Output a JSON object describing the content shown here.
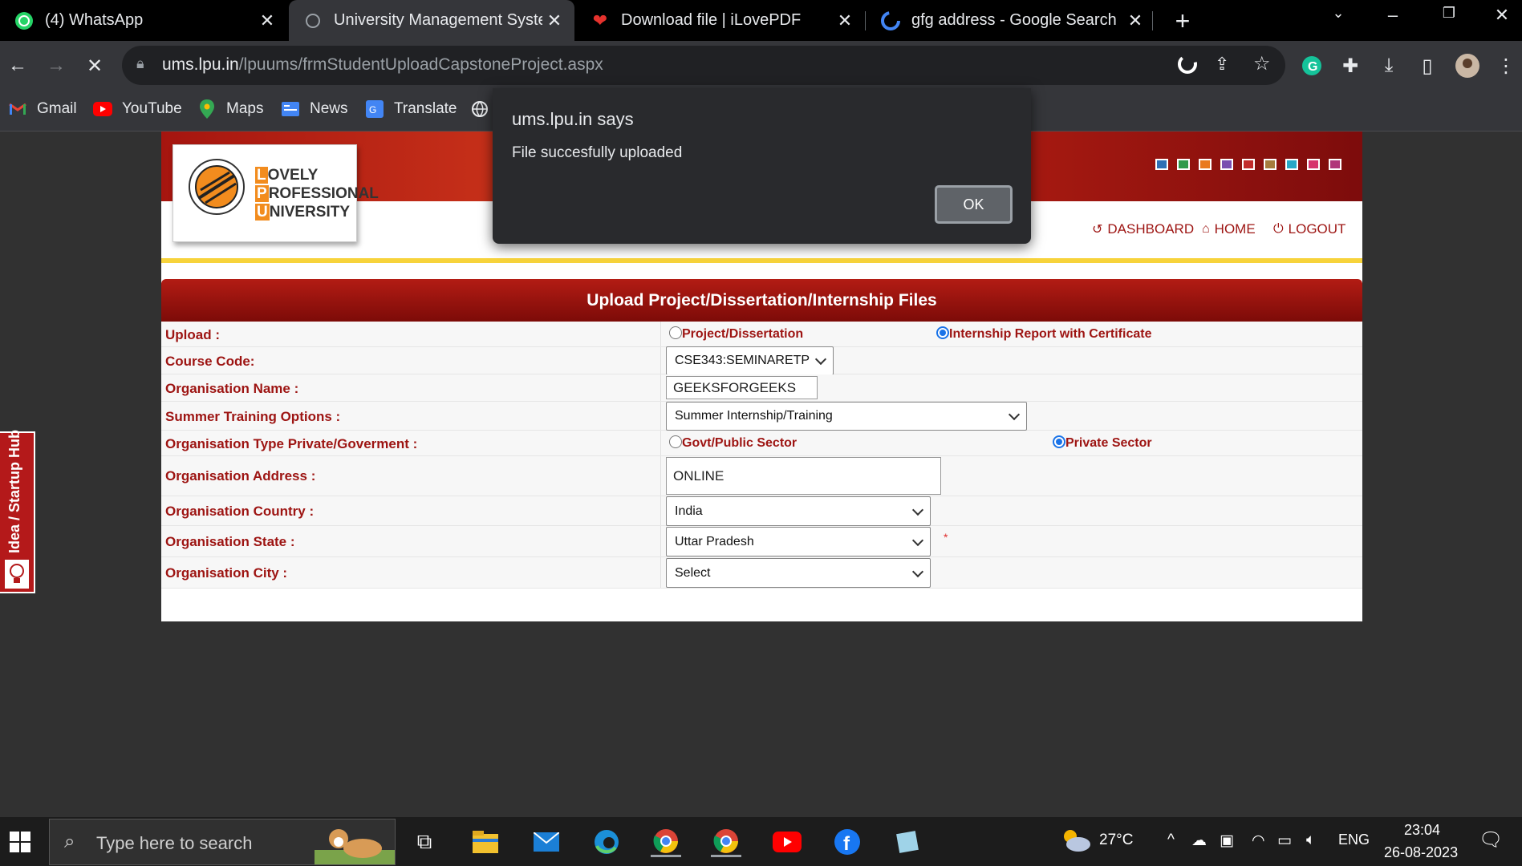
{
  "browser": {
    "tabs": [
      {
        "title": "(4) WhatsApp",
        "active": false
      },
      {
        "title": "University Management System -",
        "active": true
      },
      {
        "title": "Download file | iLovePDF",
        "active": false
      },
      {
        "title": "gfg address - Google Search",
        "active": false
      }
    ],
    "url_host": "ums.lpu.in",
    "url_path": "/lpuums/frmStudentUploadCapstoneProject.aspx",
    "bookmarks": [
      "Gmail",
      "YouTube",
      "Maps",
      "News",
      "Translate"
    ]
  },
  "dialog": {
    "title": "ums.lpu.in says",
    "message": "File succesfully uploaded",
    "ok_label": "OK"
  },
  "header": {
    "logo_line1": "OVELY",
    "logo_line2": "ROFESSIONAL",
    "logo_line3": "NIVERSITY",
    "logo_l": "L",
    "logo_p": "P",
    "logo_u": "U",
    "nav_dashboard": "DASHBOARD",
    "nav_home": "HOME",
    "nav_logout": "LOGOUT"
  },
  "form": {
    "title": "Upload Project/Dissertation/Internship Files",
    "upload_label": "Upload :",
    "upload_opt1": "Project/Dissertation",
    "upload_opt2": "Internship Report with Certificate",
    "course_label": "Course Code:",
    "course_value": "CSE343:SEMINARETP",
    "org_name_label": "Organisation Name :",
    "org_name_value": "GEEKSFORGEEKS",
    "training_label": "Summer Training Options :",
    "training_value": "Summer Internship/Training",
    "org_type_label": "Organisation Type Private/Goverment :",
    "org_type_opt1": "Govt/Public Sector",
    "org_type_opt2": "Private Sector",
    "address_label": "Organisation Address :",
    "address_value": "ONLINE",
    "country_label": "Organisation Country :",
    "country_value": "India",
    "state_label": "Organisation State :",
    "state_value": "Uttar Pradesh",
    "required_mark": "*",
    "city_label": "Organisation City :",
    "city_value": "Select"
  },
  "side_tab": {
    "text": "Idea / Startup Hub"
  },
  "taskbar": {
    "search_placeholder": "Type here to search",
    "temperature": "27°C",
    "language": "ENG",
    "time": "23:04",
    "date": "26-08-2023"
  },
  "colors": {
    "brand_red": "#9d1412",
    "banner_red": "#b81f13",
    "accent_yellow": "#f7d33b",
    "swatches": [
      "#2f6fb5",
      "#2e9a4a",
      "#e97a1f",
      "#7b4fb0",
      "#c22b2b",
      "#a67c3d",
      "#27a7c6",
      "#d6336c",
      "#b0357a"
    ]
  }
}
